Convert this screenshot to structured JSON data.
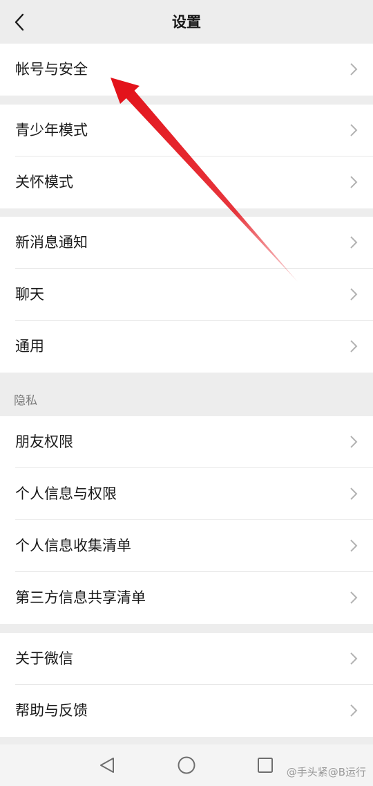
{
  "header": {
    "title": "设置",
    "back_icon": "chevron-left-icon"
  },
  "groups": [
    {
      "items": [
        {
          "label": "帐号与安全"
        }
      ]
    },
    {
      "items": [
        {
          "label": "青少年模式"
        },
        {
          "label": "关怀模式"
        }
      ]
    },
    {
      "items": [
        {
          "label": "新消息通知"
        },
        {
          "label": "聊天"
        },
        {
          "label": "通用"
        }
      ]
    },
    {
      "section_label": "隐私",
      "items": [
        {
          "label": "朋友权限"
        },
        {
          "label": "个人信息与权限"
        },
        {
          "label": "个人信息收集清单"
        },
        {
          "label": "第三方信息共享清单"
        }
      ]
    },
    {
      "items": [
        {
          "label": "关于微信"
        },
        {
          "label": "帮助与反馈"
        }
      ]
    }
  ],
  "annotation": {
    "color": "#e3131b",
    "icon": "red-arrow-icon"
  },
  "navbar": {
    "back": "triangle-back-icon",
    "home": "circle-home-icon",
    "recents": "square-recents-icon"
  },
  "watermark": "@手头紧@B运行"
}
